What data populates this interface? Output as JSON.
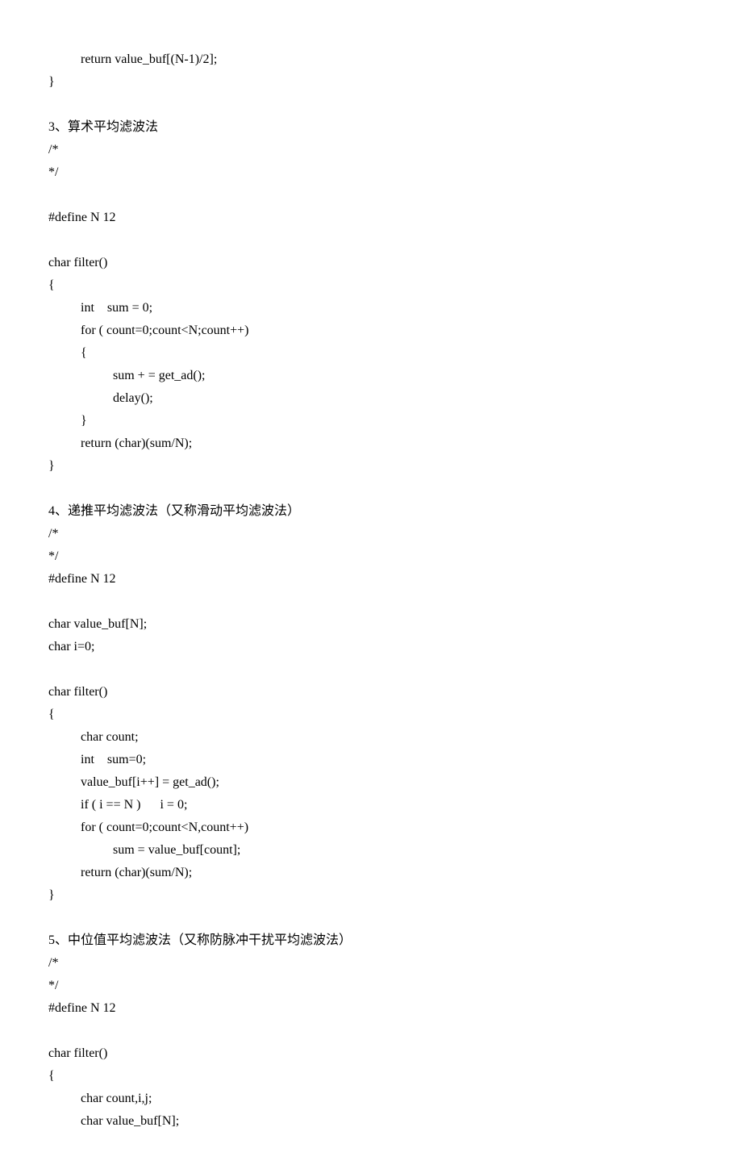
{
  "lines": [
    {
      "indent": 1,
      "text": "return value_buf[(N-1)/2];"
    },
    {
      "indent": 0,
      "text": "}"
    },
    {
      "indent": 0,
      "text": ""
    },
    {
      "indent": 0,
      "text": "3、算术平均滤波法"
    },
    {
      "indent": 0,
      "text": "/*"
    },
    {
      "indent": 0,
      "text": "*/"
    },
    {
      "indent": 0,
      "text": ""
    },
    {
      "indent": 0,
      "text": "#define N 12"
    },
    {
      "indent": 0,
      "text": ""
    },
    {
      "indent": 0,
      "text": "char filter()"
    },
    {
      "indent": 0,
      "text": "{"
    },
    {
      "indent": 1,
      "text": "int    sum = 0;"
    },
    {
      "indent": 1,
      "text": "for ( count=0;count<N;count++)"
    },
    {
      "indent": 1,
      "text": "{"
    },
    {
      "indent": 2,
      "text": "sum + = get_ad();"
    },
    {
      "indent": 2,
      "text": "delay();"
    },
    {
      "indent": 1,
      "text": "}"
    },
    {
      "indent": 1,
      "text": "return (char)(sum/N);"
    },
    {
      "indent": 0,
      "text": "}"
    },
    {
      "indent": 0,
      "text": ""
    },
    {
      "indent": 0,
      "text": "4、递推平均滤波法（又称滑动平均滤波法）"
    },
    {
      "indent": 0,
      "text": "/*"
    },
    {
      "indent": 0,
      "text": "*/"
    },
    {
      "indent": 0,
      "text": "#define N 12"
    },
    {
      "indent": 0,
      "text": ""
    },
    {
      "indent": 0,
      "text": "char value_buf[N];"
    },
    {
      "indent": 0,
      "text": "char i=0;"
    },
    {
      "indent": 0,
      "text": ""
    },
    {
      "indent": 0,
      "text": "char filter()"
    },
    {
      "indent": 0,
      "text": "{"
    },
    {
      "indent": 1,
      "text": "char count;"
    },
    {
      "indent": 1,
      "text": "int    sum=0;"
    },
    {
      "indent": 1,
      "text": "value_buf[i++] = get_ad();"
    },
    {
      "indent": 1,
      "text": "if ( i == N )      i = 0;"
    },
    {
      "indent": 1,
      "text": "for ( count=0;count<N,count++)"
    },
    {
      "indent": 2,
      "text": "sum = value_buf[count];"
    },
    {
      "indent": 1,
      "text": "return (char)(sum/N);"
    },
    {
      "indent": 0,
      "text": "}"
    },
    {
      "indent": 0,
      "text": ""
    },
    {
      "indent": 0,
      "text": "5、中位值平均滤波法（又称防脉冲干扰平均滤波法）"
    },
    {
      "indent": 0,
      "text": "/*"
    },
    {
      "indent": 0,
      "text": "*/"
    },
    {
      "indent": 0,
      "text": "#define N 12"
    },
    {
      "indent": 0,
      "text": ""
    },
    {
      "indent": 0,
      "text": "char filter()"
    },
    {
      "indent": 0,
      "text": "{"
    },
    {
      "indent": 1,
      "text": "char count,i,j;"
    },
    {
      "indent": 1,
      "text": "char value_buf[N];"
    }
  ]
}
